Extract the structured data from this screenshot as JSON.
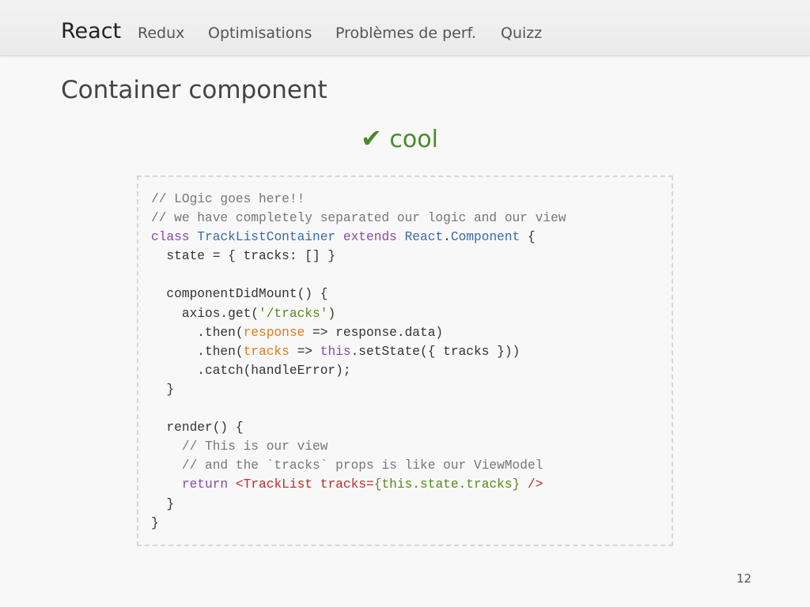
{
  "nav": {
    "items": [
      "React",
      "Redux",
      "Optimisations",
      "Problèmes de perf.",
      "Quizz"
    ]
  },
  "slide": {
    "title": "Container component",
    "badge_icon": "✔",
    "badge_text": "cool",
    "page_number": "12"
  },
  "code": {
    "lines": [
      [
        {
          "t": "// LOgic goes here!!",
          "c": "cmt"
        }
      ],
      [
        {
          "t": "// we have completely separated our logic and our view",
          "c": "cmt"
        }
      ],
      [
        {
          "t": "class",
          "c": "kw"
        },
        {
          "t": " "
        },
        {
          "t": "TrackListContainer",
          "c": "cls"
        },
        {
          "t": " "
        },
        {
          "t": "extends",
          "c": "kw"
        },
        {
          "t": " "
        },
        {
          "t": "React",
          "c": "cls"
        },
        {
          "t": "."
        },
        {
          "t": "Component",
          "c": "cls"
        },
        {
          "t": " {"
        }
      ],
      [
        {
          "t": "  state = { tracks: [] }"
        }
      ],
      [
        {
          "t": ""
        }
      ],
      [
        {
          "t": "  componentDidMount() {"
        }
      ],
      [
        {
          "t": "    axios.get("
        },
        {
          "t": "'/tracks'",
          "c": "str"
        },
        {
          "t": ")"
        }
      ],
      [
        {
          "t": "      .then("
        },
        {
          "t": "response",
          "c": "arg"
        },
        {
          "t": " => response.data)"
        }
      ],
      [
        {
          "t": "      .then("
        },
        {
          "t": "tracks",
          "c": "arg"
        },
        {
          "t": " => "
        },
        {
          "t": "this",
          "c": "kw"
        },
        {
          "t": ".setState({ tracks }))"
        }
      ],
      [
        {
          "t": "      .catch(handleError);"
        }
      ],
      [
        {
          "t": "  }"
        }
      ],
      [
        {
          "t": ""
        }
      ],
      [
        {
          "t": "  render() {"
        }
      ],
      [
        {
          "t": "    // This is our view",
          "c": "cmt"
        }
      ],
      [
        {
          "t": "    // and the `tracks` props is like our ViewModel",
          "c": "cmt"
        }
      ],
      [
        {
          "t": "    "
        },
        {
          "t": "return",
          "c": "kw"
        },
        {
          "t": " "
        },
        {
          "t": "<TrackList tracks=",
          "c": "tag"
        },
        {
          "t": "{this.state.tracks}",
          "c": "str"
        },
        {
          "t": " />",
          "c": "tag"
        }
      ],
      [
        {
          "t": "  }"
        }
      ],
      [
        {
          "t": "}"
        }
      ]
    ]
  }
}
